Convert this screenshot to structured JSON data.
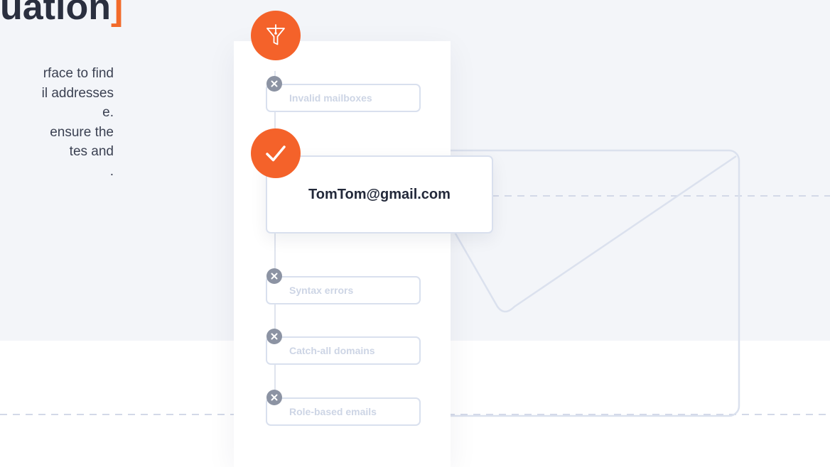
{
  "hero": {
    "title_text": "uation",
    "title_bracket": "]",
    "description_lines": [
      "rface to find",
      "il addresses",
      "e.",
      "ensure the",
      "tes and",
      "."
    ]
  },
  "flow": {
    "checks": [
      {
        "label": "Invalid mailboxes",
        "status": "rejected",
        "icon": "x-icon"
      },
      {
        "label": "Syntax errors",
        "status": "rejected",
        "icon": "x-icon"
      },
      {
        "label": "Catch-all domains",
        "status": "rejected",
        "icon": "x-icon"
      },
      {
        "label": "Role-based emails",
        "status": "rejected",
        "icon": "x-icon"
      }
    ],
    "valid_email": "TomTom@gmail.com",
    "filter_icon": "funnel-icon",
    "valid_icon": "checkmark-icon",
    "envelope_icon": "envelope-icon"
  },
  "colors": {
    "accent": "#f4622a",
    "background_band": "#f3f5f9",
    "muted_border": "#d9e0ee",
    "reject_badge": "#8c93a3"
  }
}
